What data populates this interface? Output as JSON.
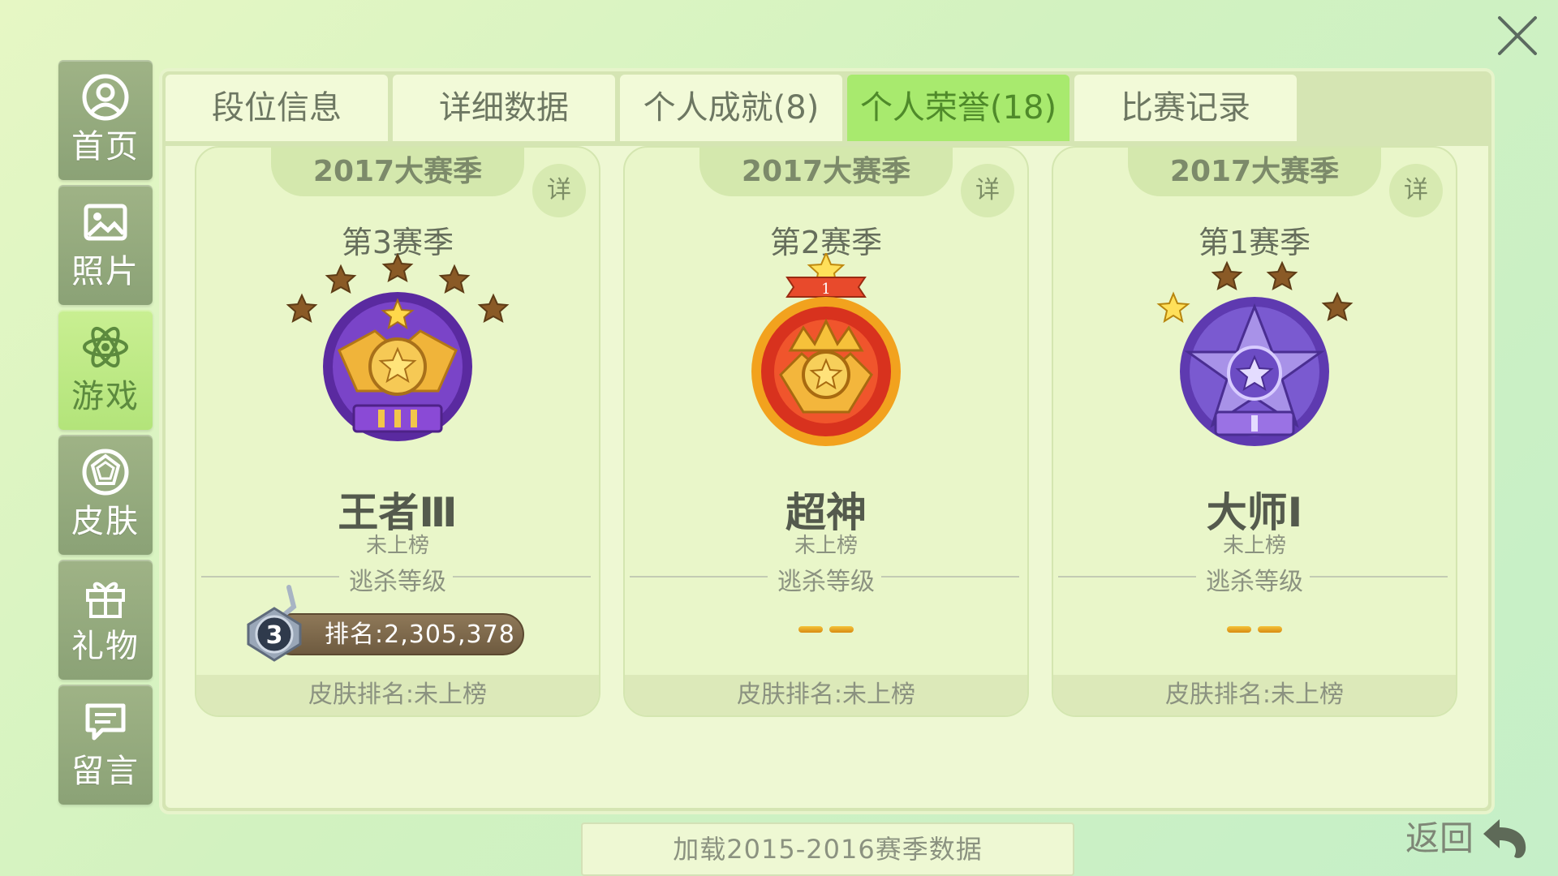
{
  "window": {
    "close_icon": "close-icon"
  },
  "sidebar": {
    "items": [
      {
        "label": "首页",
        "icon": "user-icon",
        "active": false
      },
      {
        "label": "照片",
        "icon": "image-icon",
        "active": false
      },
      {
        "label": "游戏",
        "icon": "atom-icon",
        "active": true
      },
      {
        "label": "皮肤",
        "icon": "gem-icon",
        "active": false
      },
      {
        "label": "礼物",
        "icon": "gift-icon",
        "active": false
      },
      {
        "label": "留言",
        "icon": "message-icon",
        "active": false
      }
    ]
  },
  "tabs": [
    {
      "label": "段位信息",
      "active": false
    },
    {
      "label": "详细数据",
      "active": false
    },
    {
      "label": "个人成就(8)",
      "active": false
    },
    {
      "label": "个人荣誉(18)",
      "active": true
    },
    {
      "label": "比赛记录",
      "active": false
    }
  ],
  "cards": [
    {
      "header": "2017大赛季",
      "detail_label": "详",
      "season": "第3赛季",
      "rank_name": "王者Ⅲ",
      "rank_status": "未上榜",
      "section_label": "逃杀等级",
      "escape_rank": "排名:2,305,378",
      "escape_level": "3",
      "footer": "皮肤排名:未上榜",
      "emblem": "king-emblem",
      "stars_filled": 5,
      "stars_total": 5
    },
    {
      "header": "2017大赛季",
      "detail_label": "详",
      "season": "第2赛季",
      "rank_name": "超神",
      "rank_status": "未上榜",
      "section_label": "逃杀等级",
      "footer": "皮肤排名:未上榜",
      "emblem": "god-emblem",
      "star_count": "1"
    },
    {
      "header": "2017大赛季",
      "detail_label": "详",
      "season": "第1赛季",
      "rank_name": "大师Ⅰ",
      "rank_status": "未上榜",
      "section_label": "逃杀等级",
      "footer": "皮肤排名:未上榜",
      "emblem": "master-emblem",
      "stars_filled": 1,
      "stars_total": 4
    }
  ],
  "load_button": "加载2015-2016赛季数据",
  "back_button": {
    "label": "返回",
    "icon": "back-arrow-icon"
  },
  "colors": {
    "tab_active": "#a8ea6e",
    "sidebar_active": "#b3e47a",
    "sidebar_item": "#8ba276",
    "star_gold": "#f4c23a",
    "star_bronze": "#8a5a26"
  }
}
